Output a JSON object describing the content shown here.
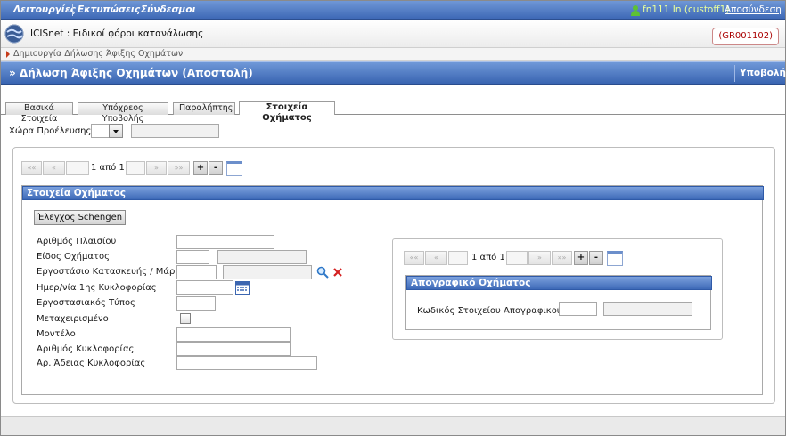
{
  "menu": {
    "items": [
      "Λειτουργίες",
      "Εκτυπώσεις",
      "Σύνδεσμοι"
    ],
    "user": "fn111 In (custoff1)",
    "logout": "Αποσύνδεση"
  },
  "app": {
    "title": "ICISnet : Ειδικοί φόροι κατανάλωσης",
    "code": "(GR001102)",
    "breadcrumb": "Δημιουργία Δήλωσης Άφιξης Οχημάτων"
  },
  "page": {
    "title": "» Δήλωση Άφιξης Οχημάτων (Αποστολή)",
    "submit": "Υποβολή"
  },
  "tabs": [
    {
      "label": "Βασικά Στοιχεία",
      "active": false
    },
    {
      "label": "Υπόχρεος Υποβολής",
      "active": false
    },
    {
      "label": "Παραλήπτης",
      "active": false
    },
    {
      "label": "Στοιχεία Οχήματος",
      "active": true
    }
  ],
  "origin": {
    "label": "Χώρα Προέλευσης",
    "code": "",
    "name": ""
  },
  "pager_outer": {
    "first": "««",
    "prev": "«",
    "text": "1 από 1",
    "next": "»",
    "last": "»»",
    "add": "+",
    "remove": "-"
  },
  "vehicle_section": {
    "title": "Στοιχεία Οχήματος",
    "schengen_button": "Έλεγχος Schengen",
    "fields": {
      "chassis": "Αριθμός Πλαισίου",
      "vehicle_type": "Είδος Οχήματος",
      "manufacturer": "Εργοστάσιο Κατασκευής / Μάρκα",
      "first_registration": "Ημερ/νία 1ης Κυκλοφορίας",
      "factory_type": "Εργοστασιακός Τύπος",
      "used": "Μεταχειρισμένο",
      "model": "Μοντέλο",
      "plate_number": "Αριθμός Κυκλοφορίας",
      "license_number": "Αρ. Άδειας Κυκλοφορίας"
    },
    "values": {
      "chassis": "",
      "vehicle_type_code": "",
      "vehicle_type_name": "",
      "manufacturer_code": "",
      "manufacturer_name": "",
      "first_registration": "",
      "factory_type": "",
      "model": "",
      "plate_number": "",
      "license_number": ""
    },
    "used_checked": false
  },
  "pager_inner": {
    "first": "««",
    "prev": "«",
    "text": "1 από 1",
    "next": "»",
    "last": "»»",
    "add": "+",
    "remove": "-"
  },
  "inventory_section": {
    "title": "Απογραφικό Οχήματος",
    "field_label": "Κωδικός Στοιχείου Απογραφικού",
    "code": "",
    "name": ""
  },
  "icons": {
    "user": "user-icon",
    "logo": "globe-logo-icon",
    "calendar": "calendar-icon",
    "search": "magnifier-icon",
    "clear": "red-x-icon"
  },
  "colors": {
    "menu_blue": "#3e69b6",
    "title_blue": "#3964b1",
    "code_red": "#aa0000",
    "clear_red": "#d42020",
    "user_green": "#5ec234"
  }
}
